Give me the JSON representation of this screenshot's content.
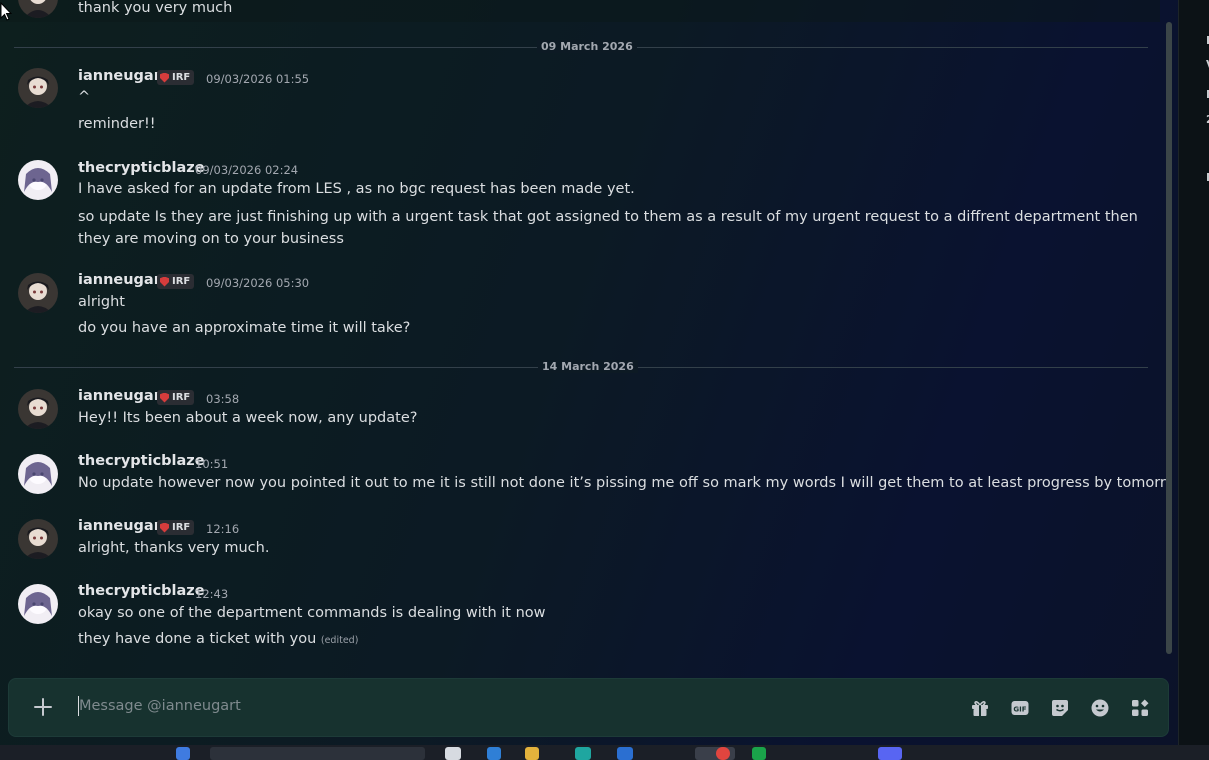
{
  "composer": {
    "placeholder": "Message @ianneugart",
    "icons": [
      "add-icon",
      "gift-icon",
      "gif-icon",
      "sticker-icon",
      "emoji-icon",
      "apps-icon"
    ]
  },
  "top_message": {
    "text": "thank you very much"
  },
  "dividers": [
    {
      "label": "09 March 2026"
    },
    {
      "label": "14 March 2026"
    }
  ],
  "messages": [
    {
      "author": "ianneugart",
      "badge": "IRF",
      "time": "09/03/2026 01:55",
      "lines": [
        "^",
        "reminder!!"
      ]
    },
    {
      "author": "thecrypticblaze",
      "time": "09/03/2026 02:24",
      "lines": [
        "I have asked for an update from LES , as no bgc request has been made yet.",
        "so update Is they are just finishing up with a urgent task that got assigned to them as a result of my urgent request to a diffrent department then they are moving on to your business"
      ]
    },
    {
      "author": "ianneugart",
      "badge": "IRF",
      "time": "09/03/2026 05:30",
      "lines": [
        "alright",
        "do you have an approximate time it will take?"
      ]
    },
    {
      "author": "ianneugart",
      "badge": "IRF",
      "time": "03:58",
      "lines": [
        "Hey!! Its been about a week now, any update?"
      ]
    },
    {
      "author": "thecrypticblaze",
      "time": "10:51",
      "lines": [
        "No update however now you pointed it out to me it is still not done it’s pissing me off so mark my words I will get them to at least progress by tomorrow"
      ]
    },
    {
      "author": "ianneugart",
      "badge": "IRF",
      "time": "12:16",
      "lines": [
        "alright, thanks very much."
      ]
    },
    {
      "author": "thecrypticblaze",
      "time": "12:43",
      "lines": [
        "okay so one of the department commands is dealing with it now",
        "they have done a ticket with you"
      ],
      "edited": "(edited)"
    }
  ],
  "right_panel": {
    "fragments": [
      "E",
      "V",
      "M",
      "2",
      "M"
    ]
  },
  "colors": {
    "accent_badge": "#d63c3c",
    "composer_bg": "#17322f"
  }
}
